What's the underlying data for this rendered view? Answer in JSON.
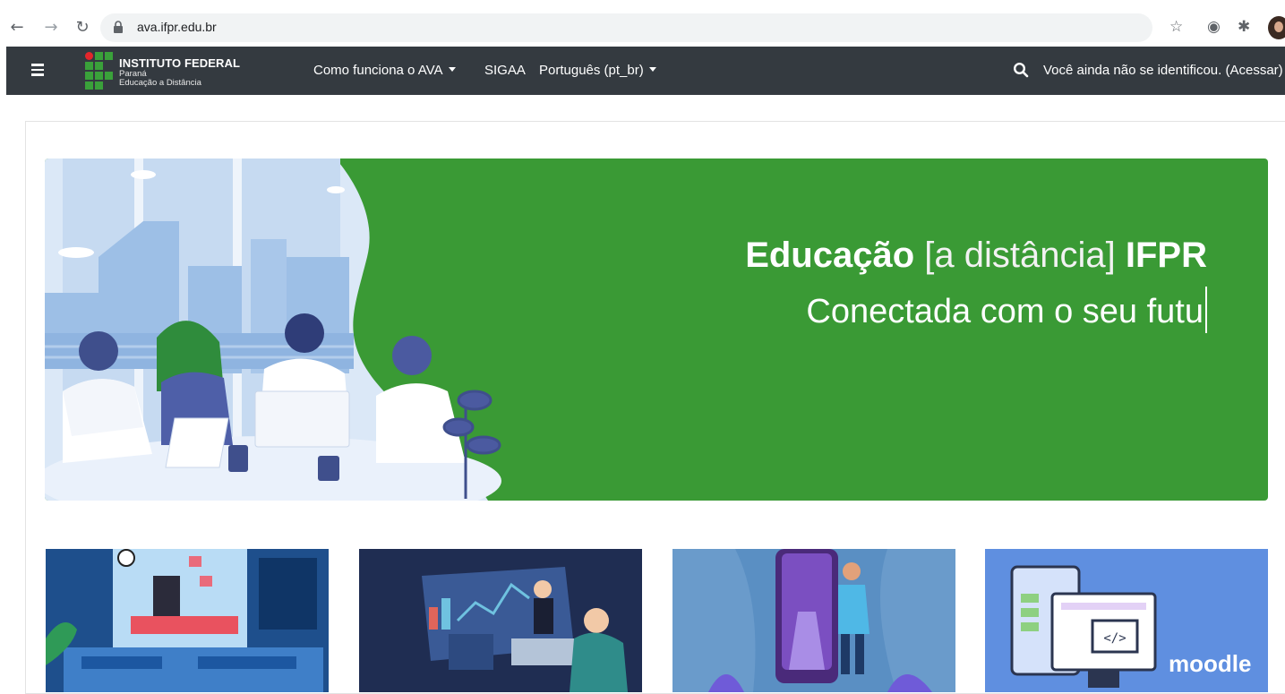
{
  "browser": {
    "url": "ava.ifpr.edu.br"
  },
  "navbar": {
    "brand": {
      "title": "INSTITUTO FEDERAL",
      "line2": "Paraná",
      "line3": "Educação a Distância"
    },
    "menu": [
      {
        "label": "Como funciona o AVA",
        "dropdown": true
      },
      {
        "label": "SIGAA",
        "dropdown": false
      },
      {
        "label": "Português (pt_br)",
        "dropdown": true
      }
    ],
    "login_text": "Você ainda não se identificou. (Acessar)"
  },
  "hero": {
    "title_bold_1": "Educação",
    "title_light": "[a distância]",
    "title_bold_2": "IFPR",
    "subtitle": "Conectada com o seu futu",
    "background_color": "#3a9a35"
  },
  "cards": [
    {
      "image": "classroom-illustration"
    },
    {
      "image": "data-presentation-illustration"
    },
    {
      "image": "phone-door-illustration"
    },
    {
      "image": "moodle-devices-illustration",
      "logo_text": "moodle"
    }
  ]
}
